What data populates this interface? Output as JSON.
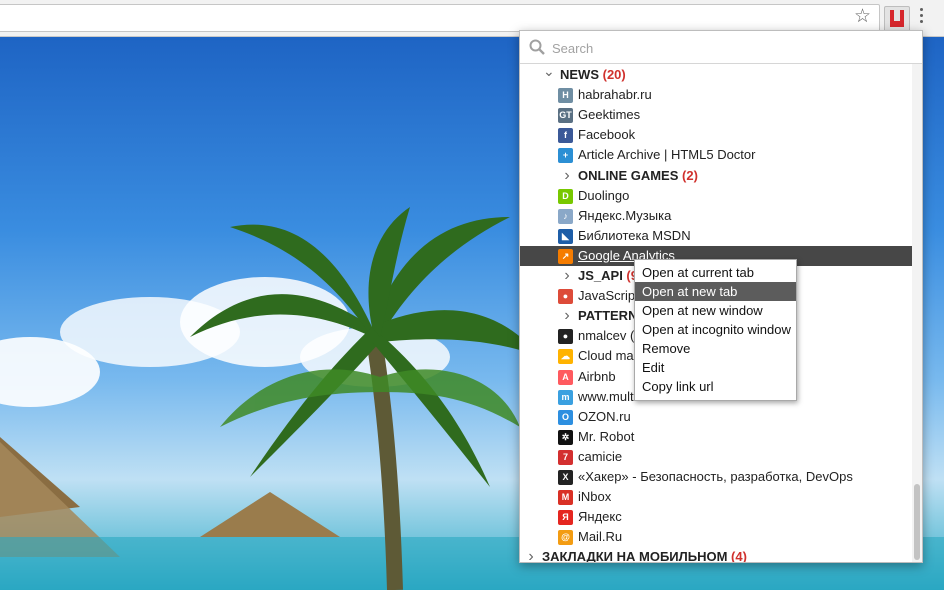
{
  "search": {
    "placeholder": "Search"
  },
  "tree": [
    {
      "kind": "folder",
      "depth": 0,
      "expanded": true,
      "label": "NEWS",
      "count": "(20)"
    },
    {
      "kind": "link",
      "label": "habrahabr.ru",
      "icon": "habr-icon",
      "color": "#6f8ea3",
      "glyph": "H"
    },
    {
      "kind": "link",
      "label": "Geektimes",
      "icon": "geektimes-icon",
      "color": "#5a7083",
      "glyph": "GT"
    },
    {
      "kind": "link",
      "label": "Facebook",
      "icon": "facebook-icon",
      "color": "#3b5998",
      "glyph": "f"
    },
    {
      "kind": "link",
      "label": "Article Archive | HTML5 Doctor",
      "icon": "html5doctor-icon",
      "color": "#2b8fd4",
      "glyph": "+"
    },
    {
      "kind": "folder",
      "depth": 1,
      "expanded": false,
      "label": "ONLINE GAMES",
      "count": "(2)"
    },
    {
      "kind": "link",
      "label": "Duolingo",
      "icon": "duolingo-icon",
      "color": "#78c800",
      "glyph": "D"
    },
    {
      "kind": "link",
      "label": "Яндекс.Музыка",
      "icon": "yandex-music-icon",
      "color": "#8aa8c8",
      "glyph": "♪"
    },
    {
      "kind": "link",
      "label": "Библиотека MSDN",
      "icon": "msdn-icon",
      "color": "#1e5ea8",
      "glyph": "◣"
    },
    {
      "kind": "link",
      "label": "Google Analytics",
      "icon": "google-analytics-icon",
      "color": "#f57c00",
      "glyph": "↗",
      "selected": true
    },
    {
      "kind": "folder",
      "depth": 1,
      "expanded": false,
      "label": "JS_API",
      "count": "(9"
    },
    {
      "kind": "link",
      "label": "JavaScrip",
      "icon": "chrome-icon",
      "color": "#dd4b39",
      "glyph": "●"
    },
    {
      "kind": "folder",
      "depth": 1,
      "expanded": false,
      "label": "PATTERN",
      "count": ""
    },
    {
      "kind": "link",
      "label": "nmalcev (",
      "icon": "github-icon",
      "color": "#222222",
      "glyph": "●"
    },
    {
      "kind": "link",
      "label": "Cloud ma",
      "icon": "cloud-icon",
      "color": "#ffb300",
      "glyph": "☁"
    },
    {
      "kind": "link",
      "label": "Airbnb",
      "icon": "airbnb-icon",
      "color": "#ff5a5f",
      "glyph": "A"
    },
    {
      "kind": "link",
      "label": "www.multitran.ru",
      "icon": "multitran-icon",
      "color": "#3aa0e0",
      "glyph": "m"
    },
    {
      "kind": "link",
      "label": "OZON.ru",
      "icon": "ozon-icon",
      "color": "#2d8fe0",
      "glyph": "O"
    },
    {
      "kind": "link",
      "label": "Mr. Robot",
      "icon": "mr-robot-icon",
      "color": "#111111",
      "glyph": "✲"
    },
    {
      "kind": "link",
      "label": "camicie",
      "icon": "camicie-icon",
      "color": "#d32f2f",
      "glyph": "7"
    },
    {
      "kind": "link",
      "label": "«Хакер» - Безопасность, разработка, DevOps",
      "icon": "xakep-icon",
      "color": "#222222",
      "glyph": "X"
    },
    {
      "kind": "link",
      "label": "iNbox",
      "icon": "gmail-icon",
      "color": "#d93025",
      "glyph": "M"
    },
    {
      "kind": "link",
      "label": "Яндекс",
      "icon": "yandex-icon",
      "color": "#e52620",
      "glyph": "Я"
    },
    {
      "kind": "link",
      "label": "Mail.Ru",
      "icon": "mailru-icon",
      "color": "#f39c12",
      "glyph": "@"
    },
    {
      "kind": "folder",
      "depth": 0,
      "expanded": false,
      "label": "ЗАКЛАДКИ НА МОБИЛЬНОМ",
      "count": "(4)"
    }
  ],
  "context_menu": {
    "items": [
      "Open at current tab",
      "Open at new tab",
      "Open at new window",
      "Open at incognito window",
      "Remove",
      "Edit",
      "Copy link url"
    ],
    "highlighted": 1
  }
}
